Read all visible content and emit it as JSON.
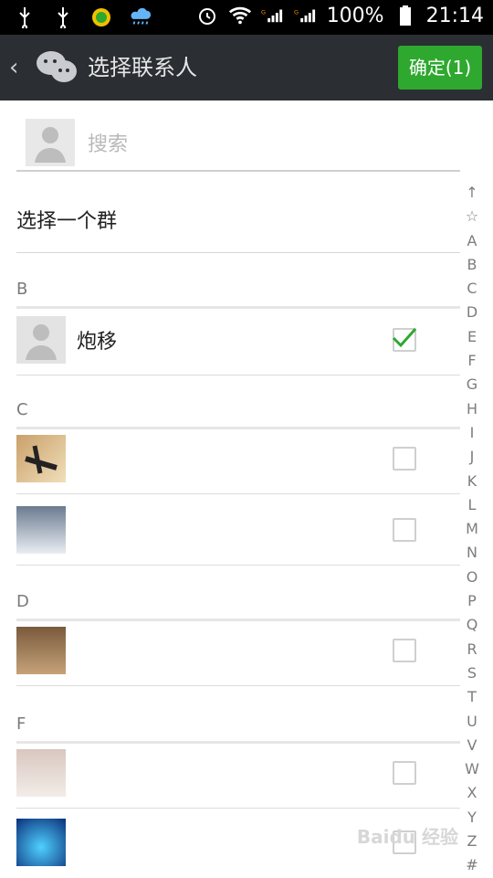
{
  "status_bar": {
    "battery": "100%",
    "time": "21:14"
  },
  "header": {
    "back_icon": "back-chevron-icon",
    "app_icon": "wechat-icon",
    "title": "选择联系人",
    "confirm_label": "确定(1)"
  },
  "search": {
    "placeholder": "搜索"
  },
  "group_item": {
    "label": "选择一个群"
  },
  "sections": [
    {
      "letter": "B",
      "contacts": [
        {
          "name": "炮移",
          "checked": true
        }
      ]
    },
    {
      "letter": "C",
      "contacts": [
        {
          "name": "",
          "checked": false
        },
        {
          "name": "",
          "checked": false
        }
      ]
    },
    {
      "letter": "D",
      "contacts": [
        {
          "name": "",
          "checked": false
        }
      ]
    },
    {
      "letter": "F",
      "contacts": [
        {
          "name": "",
          "checked": false
        },
        {
          "name": "",
          "checked": false
        }
      ]
    }
  ],
  "index_letters": [
    "↑",
    "☆",
    "A",
    "B",
    "C",
    "D",
    "E",
    "F",
    "G",
    "H",
    "I",
    "J",
    "K",
    "L",
    "M",
    "N",
    "O",
    "P",
    "Q",
    "R",
    "S",
    "T",
    "U",
    "V",
    "W",
    "X",
    "Y",
    "Z",
    "#"
  ],
  "watermark": "Baidu 经验",
  "colors": {
    "topbar": "#2b2e33",
    "accent": "#2ea82e"
  }
}
